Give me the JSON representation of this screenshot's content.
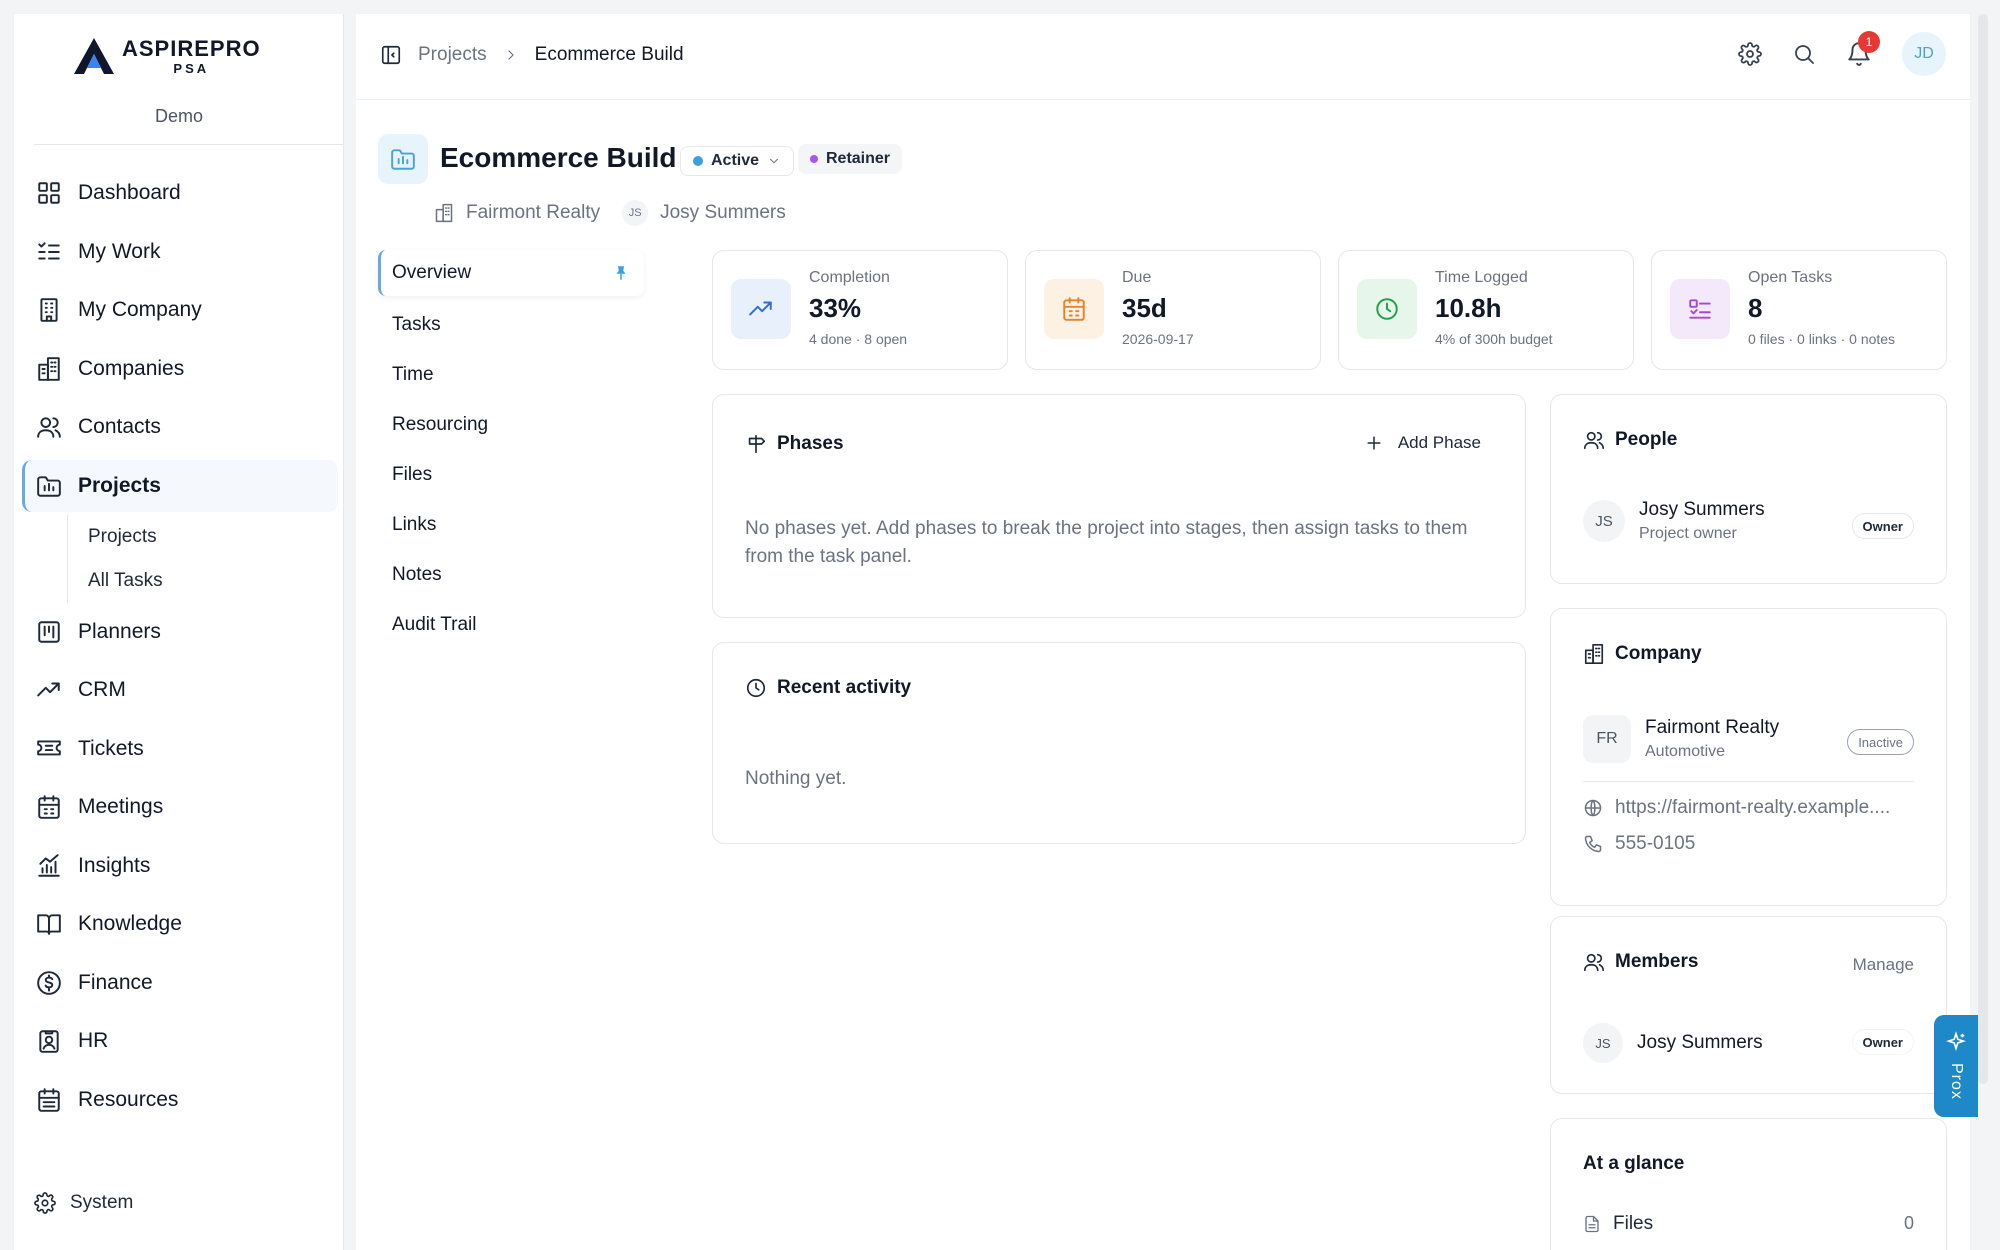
{
  "brand": {
    "name": "ASPIREPRO",
    "sub": "PSA",
    "env": "Demo"
  },
  "sidebar": {
    "items": [
      {
        "label": "Dashboard"
      },
      {
        "label": "My Work"
      },
      {
        "label": "My Company"
      },
      {
        "label": "Companies"
      },
      {
        "label": "Contacts"
      },
      {
        "label": "Projects"
      },
      {
        "label": "Planners"
      },
      {
        "label": "CRM"
      },
      {
        "label": "Tickets"
      },
      {
        "label": "Meetings"
      },
      {
        "label": "Insights"
      },
      {
        "label": "Knowledge"
      },
      {
        "label": "Finance"
      },
      {
        "label": "HR"
      },
      {
        "label": "Resources"
      }
    ],
    "projects_sub": [
      {
        "label": "Projects"
      },
      {
        "label": "All Tasks"
      }
    ],
    "system_label": "System"
  },
  "topbar": {
    "breadcrumb_root": "Projects",
    "breadcrumb_current": "Ecommerce Build",
    "notification_count": "1",
    "user_initials": "JD"
  },
  "project": {
    "title": "Ecommerce Build",
    "status": "Active",
    "status_color": "#3aa0e0",
    "type": "Retainer",
    "type_color": "#a855f7",
    "company": "Fairmont Realty",
    "owner_initials": "JS",
    "owner": "Josy Summers"
  },
  "tabs": [
    {
      "label": "Overview"
    },
    {
      "label": "Tasks"
    },
    {
      "label": "Time"
    },
    {
      "label": "Resourcing"
    },
    {
      "label": "Files"
    },
    {
      "label": "Links"
    },
    {
      "label": "Notes"
    },
    {
      "label": "Audit Trail"
    }
  ],
  "stats": {
    "completion": {
      "label": "Completion",
      "value": "33%",
      "sub": "4 done · 8 open"
    },
    "due": {
      "label": "Due",
      "value": "35d",
      "sub": "2026-09-17"
    },
    "time": {
      "label": "Time Logged",
      "value": "10.8h",
      "sub": "4% of 300h budget"
    },
    "tasks": {
      "label": "Open Tasks",
      "value": "8",
      "sub": "0 files · 0 links · 0 notes"
    }
  },
  "phases": {
    "title": "Phases",
    "add_label": "Add Phase",
    "empty": "No phases yet. Add phases to break the project into stages, then assign tasks to them from the task panel."
  },
  "activity": {
    "title": "Recent activity",
    "empty": "Nothing yet."
  },
  "people": {
    "title": "People",
    "initials": "JS",
    "name": "Josy Summers",
    "role": "Project owner",
    "tag": "Owner"
  },
  "company": {
    "title": "Company",
    "initials": "FR",
    "name": "Fairmont Realty",
    "industry": "Automotive",
    "status": "Inactive",
    "website": "https://fairmont-realty.example....",
    "phone": "555-0105"
  },
  "members": {
    "title": "Members",
    "manage": "Manage",
    "initials": "JS",
    "name": "Josy Summers",
    "tag": "Owner"
  },
  "glance": {
    "title": "At a glance",
    "files_label": "Files",
    "files_count": "0"
  },
  "prox": {
    "label": "Prox"
  }
}
